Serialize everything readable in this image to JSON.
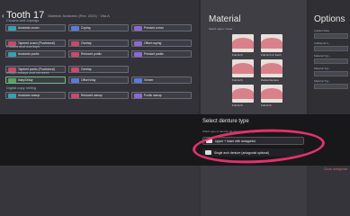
{
  "header": {
    "title": "Tooth 17",
    "subtitle": "Material: Anatomic (Rev. 2024) · Vita A",
    "back_icon": "chevron-left-icon"
  },
  "sections": [
    {
      "label": "Crowns and copings",
      "buttons": [
        {
          "label": "Anatomic crown",
          "icon": "teal"
        },
        {
          "label": "Coping",
          "icon": "blue"
        },
        {
          "label": "Pressed crown",
          "icon": "purple"
        }
      ]
    },
    {
      "label": "",
      "buttons": [
        {
          "label": "Tapered crown (Provisional)",
          "icon": "red"
        },
        {
          "label": "Overlap",
          "icon": "red"
        },
        {
          "label": "Offset coping",
          "icon": "purple"
        }
      ]
    },
    {
      "label": "Pontics and overlays",
      "buttons": [
        {
          "label": "Anatomic pontic",
          "icon": "teal"
        },
        {
          "label": "Reduced pontic",
          "icon": "red"
        },
        {
          "label": "Pressed pontic",
          "icon": "purple"
        }
      ]
    },
    {
      "label": "",
      "buttons": [
        {
          "label": "Tapered pontic (Provisional)",
          "icon": "red"
        },
        {
          "label": "Overlap",
          "icon": "red"
        }
      ]
    },
    {
      "label": "Inlays, onlays and veneers",
      "buttons": [
        {
          "label": "Inlay/Onlay",
          "icon": "green"
        },
        {
          "label": "Offset inlay",
          "icon": "blue"
        },
        {
          "label": "Veneer",
          "icon": "blue"
        }
      ]
    },
    {
      "label": "Digital copy milling",
      "buttons": [
        {
          "label": "Anatomic waxup",
          "icon": "teal"
        },
        {
          "label": "Reduced waxup",
          "icon": "red"
        },
        {
          "label": "Pontic waxup",
          "icon": "purple"
        }
      ]
    }
  ],
  "material": {
    "title": "Material",
    "subtitle": "Select upper / lower",
    "thumbs": [
      "Full Arch",
      "Full Arch & Tooth",
      "Full Arch",
      "Partial Denture",
      "Full Arch",
      "Full Arch"
    ]
  },
  "options": {
    "title": "Options",
    "items": [
      "Implant base",
      "Additional fi...",
      "Material Typ...",
      "Material Typ...",
      "Material Typ..."
    ]
  },
  "dialog": {
    "title": "Select denture type",
    "subtitle": "Which type of denture do you want to design?",
    "options": [
      {
        "label": "Upper + lower with antagonist"
      },
      {
        "label": "Single arch denture (antagonist optional)"
      }
    ],
    "close_label": "Close antagonist"
  },
  "colors": {
    "highlight": "#e0336a"
  }
}
